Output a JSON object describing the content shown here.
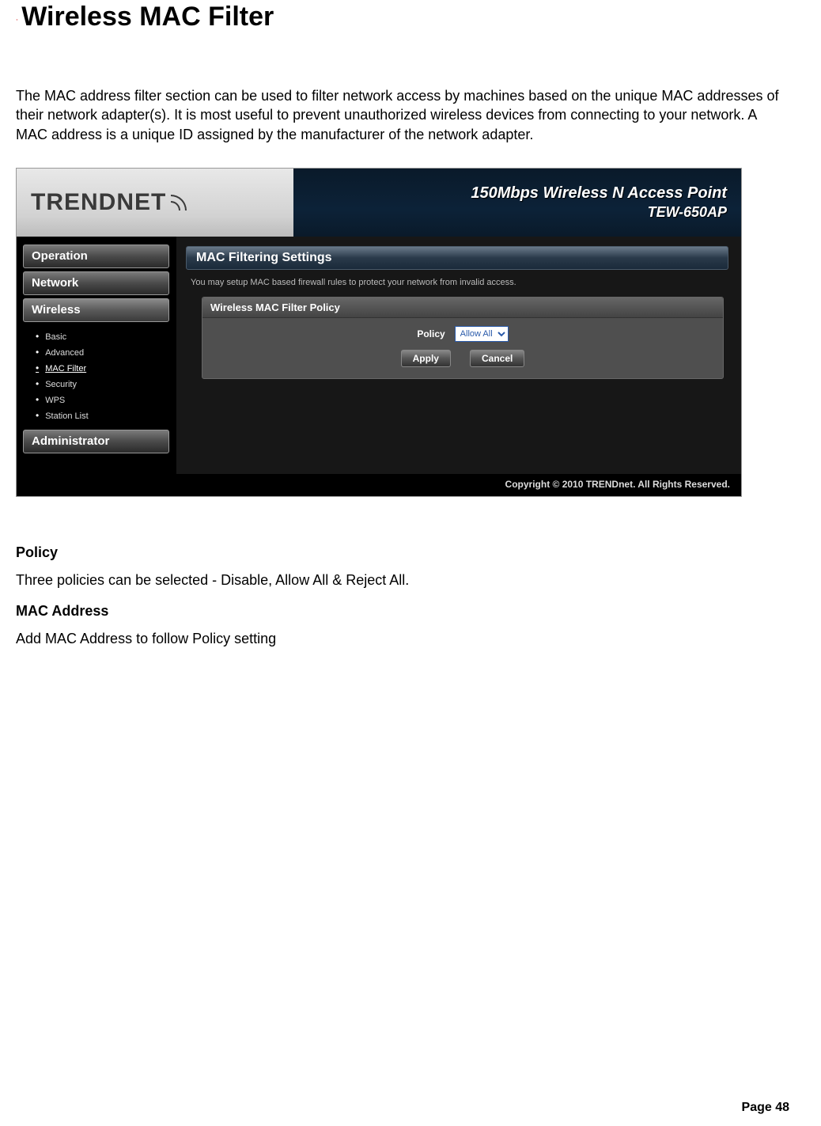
{
  "doc": {
    "title": "Wireless MAC Filter",
    "intro": "The MAC address filter section can be used to filter network access by machines based on the unique MAC addresses of their network adapter(s). It is most useful to prevent unauthorized wireless devices from connecting to your network. A MAC address is a unique ID assigned by the manufacturer of the network adapter.",
    "policy_heading": "Policy",
    "policy_text": "Three policies can be selected - Disable, Allow All & Reject All.",
    "mac_heading": "MAC Address",
    "mac_text": "Add MAC Address to follow Policy setting",
    "page_label": "Page  48"
  },
  "router": {
    "brand": "TRENDNET",
    "product_line1": "150Mbps Wireless N Access Point",
    "product_line2": "TEW-650AP",
    "nav": {
      "operation": "Operation",
      "network": "Network",
      "wireless": "Wireless",
      "administrator": "Administrator"
    },
    "wireless_sub": {
      "basic": "Basic",
      "advanced": "Advanced",
      "mac_filter": "MAC Filter",
      "security": "Security",
      "wps": "WPS",
      "station_list": "Station List"
    },
    "panel": {
      "title": "MAC Filtering Settings",
      "desc": "You may setup MAC based firewall rules to protect your network from invalid access.",
      "inner_title": "Wireless MAC Filter Policy",
      "policy_label": "Policy",
      "policy_value": "Allow All",
      "apply": "Apply",
      "cancel": "Cancel"
    },
    "footer": "Copyright © 2010 TRENDnet. All Rights Reserved."
  }
}
